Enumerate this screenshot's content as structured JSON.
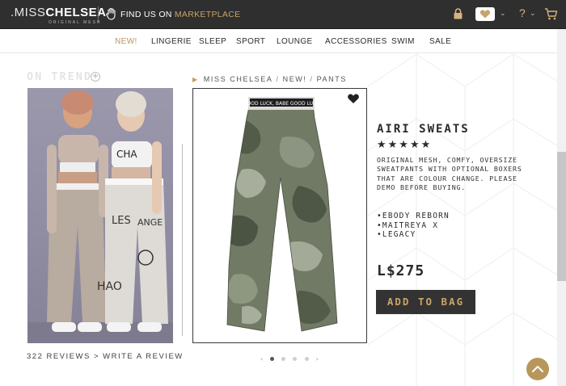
{
  "header": {
    "logo_thin": ".MISS",
    "logo_bold": "CHELSEA",
    "logo_sub": "ORIGINAL MESH",
    "findus_prefix": "FIND US ON ",
    "findus_link": "MARKETPLACE",
    "icons": [
      "hand-icon",
      "lock-icon",
      "heart-icon",
      "chevron-down-icon",
      "help-icon",
      "cart-icon"
    ],
    "help_glyph": "?"
  },
  "nav": {
    "items": [
      {
        "label": "NEW!",
        "active": true
      },
      {
        "label": "LINGERIE",
        "active": false
      },
      {
        "label": "SLEEP",
        "active": false
      },
      {
        "label": "SPORT",
        "active": false
      },
      {
        "label": "LOUNGE",
        "active": false
      },
      {
        "label": "ACCESSORIES",
        "active": false
      },
      {
        "label": "SWIM",
        "active": false
      },
      {
        "label": "SALE",
        "active": false
      }
    ]
  },
  "trend": {
    "heading": "ON TREND",
    "plus": "+",
    "reviews_text": "322 REVIEWS > WRITE A REVIEW"
  },
  "breadcrumb": {
    "items": [
      "MISS CHELSEA",
      "NEW!",
      "PANTS"
    ],
    "separator": "/"
  },
  "product": {
    "title": "AIRI SWEATS",
    "stars": "★★★★★",
    "rating": 5,
    "description": "ORIGINAL MESH, COMFY, OVERSIZE SWEATPANTS WITH OPTIONAL BOXERS THAT ARE COLOUR CHANGE. PLEASE DEMO BEFORE BUYING.",
    "bodies": [
      "•EBODY REBORN",
      "•MAITREYA X",
      "•LEGACY"
    ],
    "price": "L$275",
    "add_to_bag": "ADD TO BAG",
    "waistband_text": "GOOD LUCK, BABE   GOOD LUCK",
    "carousel": {
      "count": 4,
      "active": 1
    }
  },
  "colors": {
    "topbar": "#2f2f2f",
    "gold": "#c8a46a",
    "active_nav": "#b8955d",
    "button_bg": "#333333"
  }
}
